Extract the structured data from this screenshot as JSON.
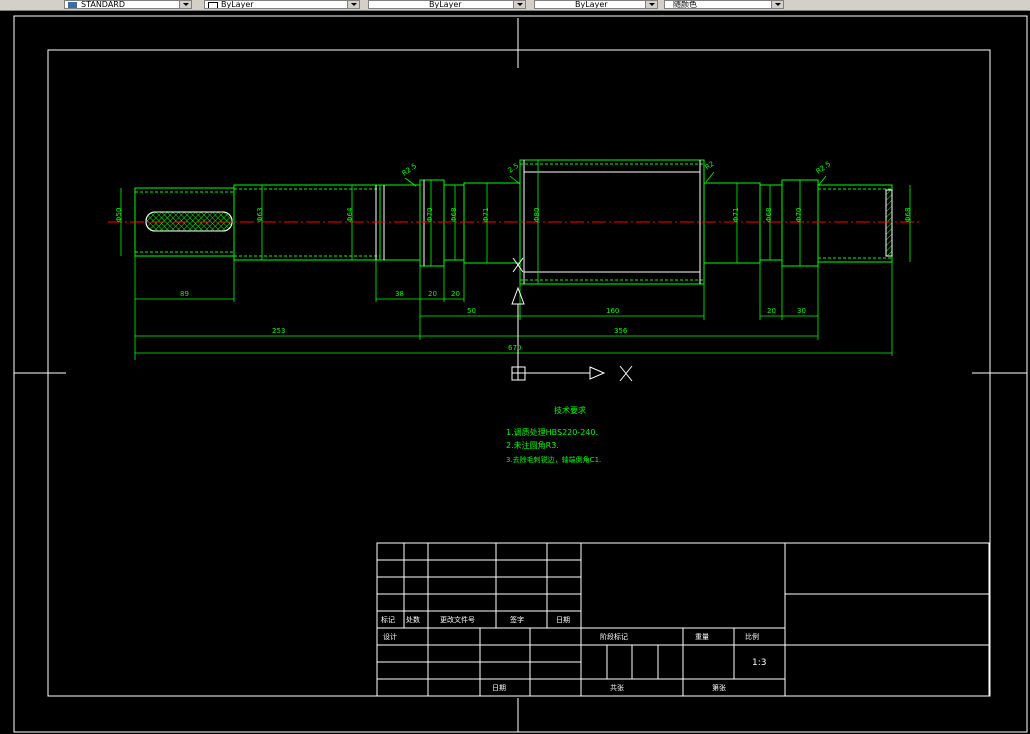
{
  "toolbar": {
    "layer_value": "STANDARD",
    "color_value": "ByLayer",
    "linetype_value": "ByLayer",
    "lineweight_value": "ByLayer",
    "plotstyle_value": "随颜色"
  },
  "drawing": {
    "diameters": {
      "d1": "Φ50",
      "d2": "Φ63",
      "d3": "Φ64",
      "d4": "Φ70",
      "d5": "Φ68",
      "d6": "Φ71",
      "d7": "Φ80",
      "d8": "Φ71",
      "d9": "Φ68",
      "d10": "Φ70",
      "d11": "Φ68"
    },
    "chamfers": {
      "c1": "R2.5",
      "c2": "2.5",
      "c3": "R2",
      "c4": "R2.5"
    },
    "dims": {
      "l_89": "89",
      "l_38": "38",
      "l_20a": "20",
      "l_20b": "20",
      "l_50": "50",
      "l_160": "160",
      "l_20c": "20",
      "l_30": "30",
      "l_253": "253",
      "l_356": "356",
      "l_670": "670"
    },
    "tech_title": "技术要求",
    "tech_items": {
      "i1": "1.调质处理HBS220-240.",
      "i2": "2.未注圆角R3.",
      "i3": "3.去除毛刺锐边，轴端倒角C1."
    }
  },
  "title_block": {
    "col_mark": "标记",
    "col_count": "处数",
    "col_file": "更改文件号",
    "col_sign": "签字",
    "col_date": "日期",
    "designer": "设计",
    "stage_mark": "阶段标记",
    "weight": "重量",
    "scale": "比例",
    "scale_value": "1:3",
    "date": "日期",
    "sheets_total": "共张",
    "sheet_no": "第张"
  },
  "colors": {
    "outline": "#ffffff",
    "shaft": "#00ff00",
    "center": "#ff0000",
    "text": "#00ff00",
    "hatch": "#00ff00"
  }
}
